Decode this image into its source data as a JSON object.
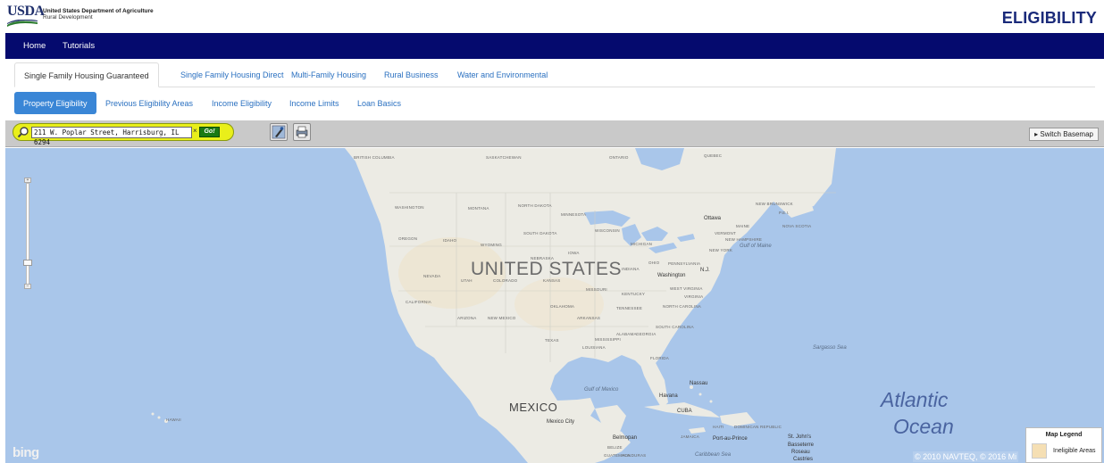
{
  "header": {
    "logo_text": "USDA",
    "agency_line1": "United States Department of Agriculture",
    "agency_line2": "Rural Development",
    "title": "ELIGIBILITY"
  },
  "navbar": {
    "items": [
      {
        "label": "Home"
      },
      {
        "label": "Tutorials"
      }
    ]
  },
  "program_tabs": [
    {
      "label": "Single Family Housing Guaranteed",
      "active": true
    },
    {
      "label": "Single Family Housing Direct",
      "active": false
    },
    {
      "label": "Multi-Family Housing",
      "active": false
    },
    {
      "label": "Rural Business",
      "active": false
    },
    {
      "label": "Water and Environmental",
      "active": false
    }
  ],
  "sub_tabs": [
    {
      "label": "Property Eligibility",
      "active": true
    },
    {
      "label": "Previous Eligibility Areas",
      "active": false
    },
    {
      "label": "Income Eligibility",
      "active": false
    },
    {
      "label": "Income Limits",
      "active": false
    },
    {
      "label": "Loan Basics",
      "active": false
    }
  ],
  "map_toolbar": {
    "search_value": "211 W. Poplar Street, Harrisburg, IL  6294",
    "clear_label": "×",
    "go_label": "Go!",
    "switch_basemap_label": "▸ Switch Basemap"
  },
  "map": {
    "country_labels": [
      "UNITED STATES",
      "MEXICO"
    ],
    "ocean_labels": [
      "Atlantic",
      "Ocean"
    ],
    "sea_labels": [
      "Sargasso Sea",
      "Gulf of Mexico",
      "Caribbean Sea",
      "Gulf of Maine"
    ],
    "region_labels": [
      "BRITISH COLUMBIA",
      "SASKATCHEWAN",
      "ONTARIO",
      "QUEBEC",
      "WASHINGTON",
      "MONTANA",
      "NORTH DAKOTA",
      "MINNESOTA",
      "OREGON",
      "IDAHO",
      "WYOMING",
      "SOUTH DAKOTA",
      "WISCONSIN",
      "MICHIGAN",
      "NEW YORK",
      "MAINE",
      "VERMONT",
      "NEW HAMPSHIRE",
      "NEW BRUNSWICK",
      "NOVA SCOTIA",
      "NEBRASKA",
      "IOWA",
      "OHIO",
      "PENNSYLVANIA",
      "INDIANA",
      "NEVADA",
      "UTAH",
      "COLORADO",
      "KANSAS",
      "MISSOURI",
      "KENTUCKY",
      "WEST VIRGINIA",
      "VIRGINIA",
      "CALIFORNIA",
      "OKLAHOMA",
      "TENNESSEE",
      "NORTH CAROLINA",
      "ARIZONA",
      "NEW MEXICO",
      "ARKANSAS",
      "SOUTH CAROLINA",
      "TEXAS",
      "MISSISSIPPI",
      "ALABAMA",
      "GEORGIA",
      "LOUISIANA",
      "FLORIDA",
      "HAWAII",
      "DOMINICAN REPUBLIC",
      "JAMAICA",
      "HAITI",
      "GUATEMALA",
      "HONDURAS",
      "BELIZE",
      "P.E.I."
    ],
    "city_labels": [
      "Ottawa",
      "Washington",
      "Havana",
      "CUBA",
      "Nassau",
      "Mexico City",
      "Belmopan",
      "Port-au-Prince",
      "Basseterre",
      "St. John's",
      "Roseau",
      "Castries",
      "N.J."
    ],
    "bing_logo": "bing",
    "copyright": "© 2010 NAVTEQ, © 2016 Mi"
  },
  "legend": {
    "title": "Map Legend",
    "items": [
      {
        "label": "Ineligible Areas",
        "color": "#f5dfb4"
      }
    ]
  },
  "colors": {
    "navbar": "#050a6e",
    "title": "#1a2a7a",
    "active_pill": "#3a86d6",
    "ocean": "#a9c6ea",
    "land": "#ecebe4",
    "search_highlight": "#e9ef1a",
    "go_button": "#1b7a14"
  },
  "icons": [
    "search-icon",
    "clear-icon",
    "identify-tool-icon",
    "print-icon",
    "zoom-in-icon",
    "zoom-out-icon"
  ]
}
